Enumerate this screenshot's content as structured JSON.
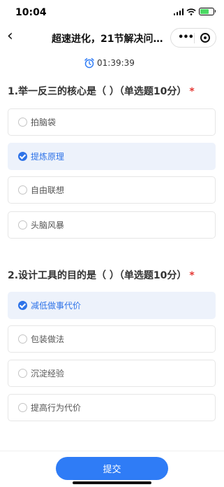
{
  "status_bar": {
    "time": "10:04"
  },
  "nav": {
    "back_icon": "chevron-left-icon",
    "title": "超速进化，21节解决问题的..."
  },
  "timer": {
    "icon": "alarm-clock-icon",
    "text": "01:39:39",
    "accent": "#2f7cf6"
  },
  "questions": [
    {
      "title": "1.举一反三的核心是（ ）（单选题10分）",
      "required_mark": "*",
      "options": [
        {
          "label": "拍脑袋",
          "selected": false
        },
        {
          "label": "提炼原理",
          "selected": true
        },
        {
          "label": "自由联想",
          "selected": false
        },
        {
          "label": "头脑风暴",
          "selected": false
        }
      ]
    },
    {
      "title": "2.设计工具的目的是（ ）（单选题10分）",
      "required_mark": "*",
      "options": [
        {
          "label": "减低做事代价",
          "selected": true
        },
        {
          "label": "包装做法",
          "selected": false
        },
        {
          "label": "沉淀经验",
          "selected": false
        },
        {
          "label": "提高行为代价",
          "selected": false
        }
      ]
    }
  ],
  "submit_label": "提交",
  "colors": {
    "accent": "#2e73e8",
    "required": "#e53935",
    "selected_bg": "#edf2fb"
  }
}
